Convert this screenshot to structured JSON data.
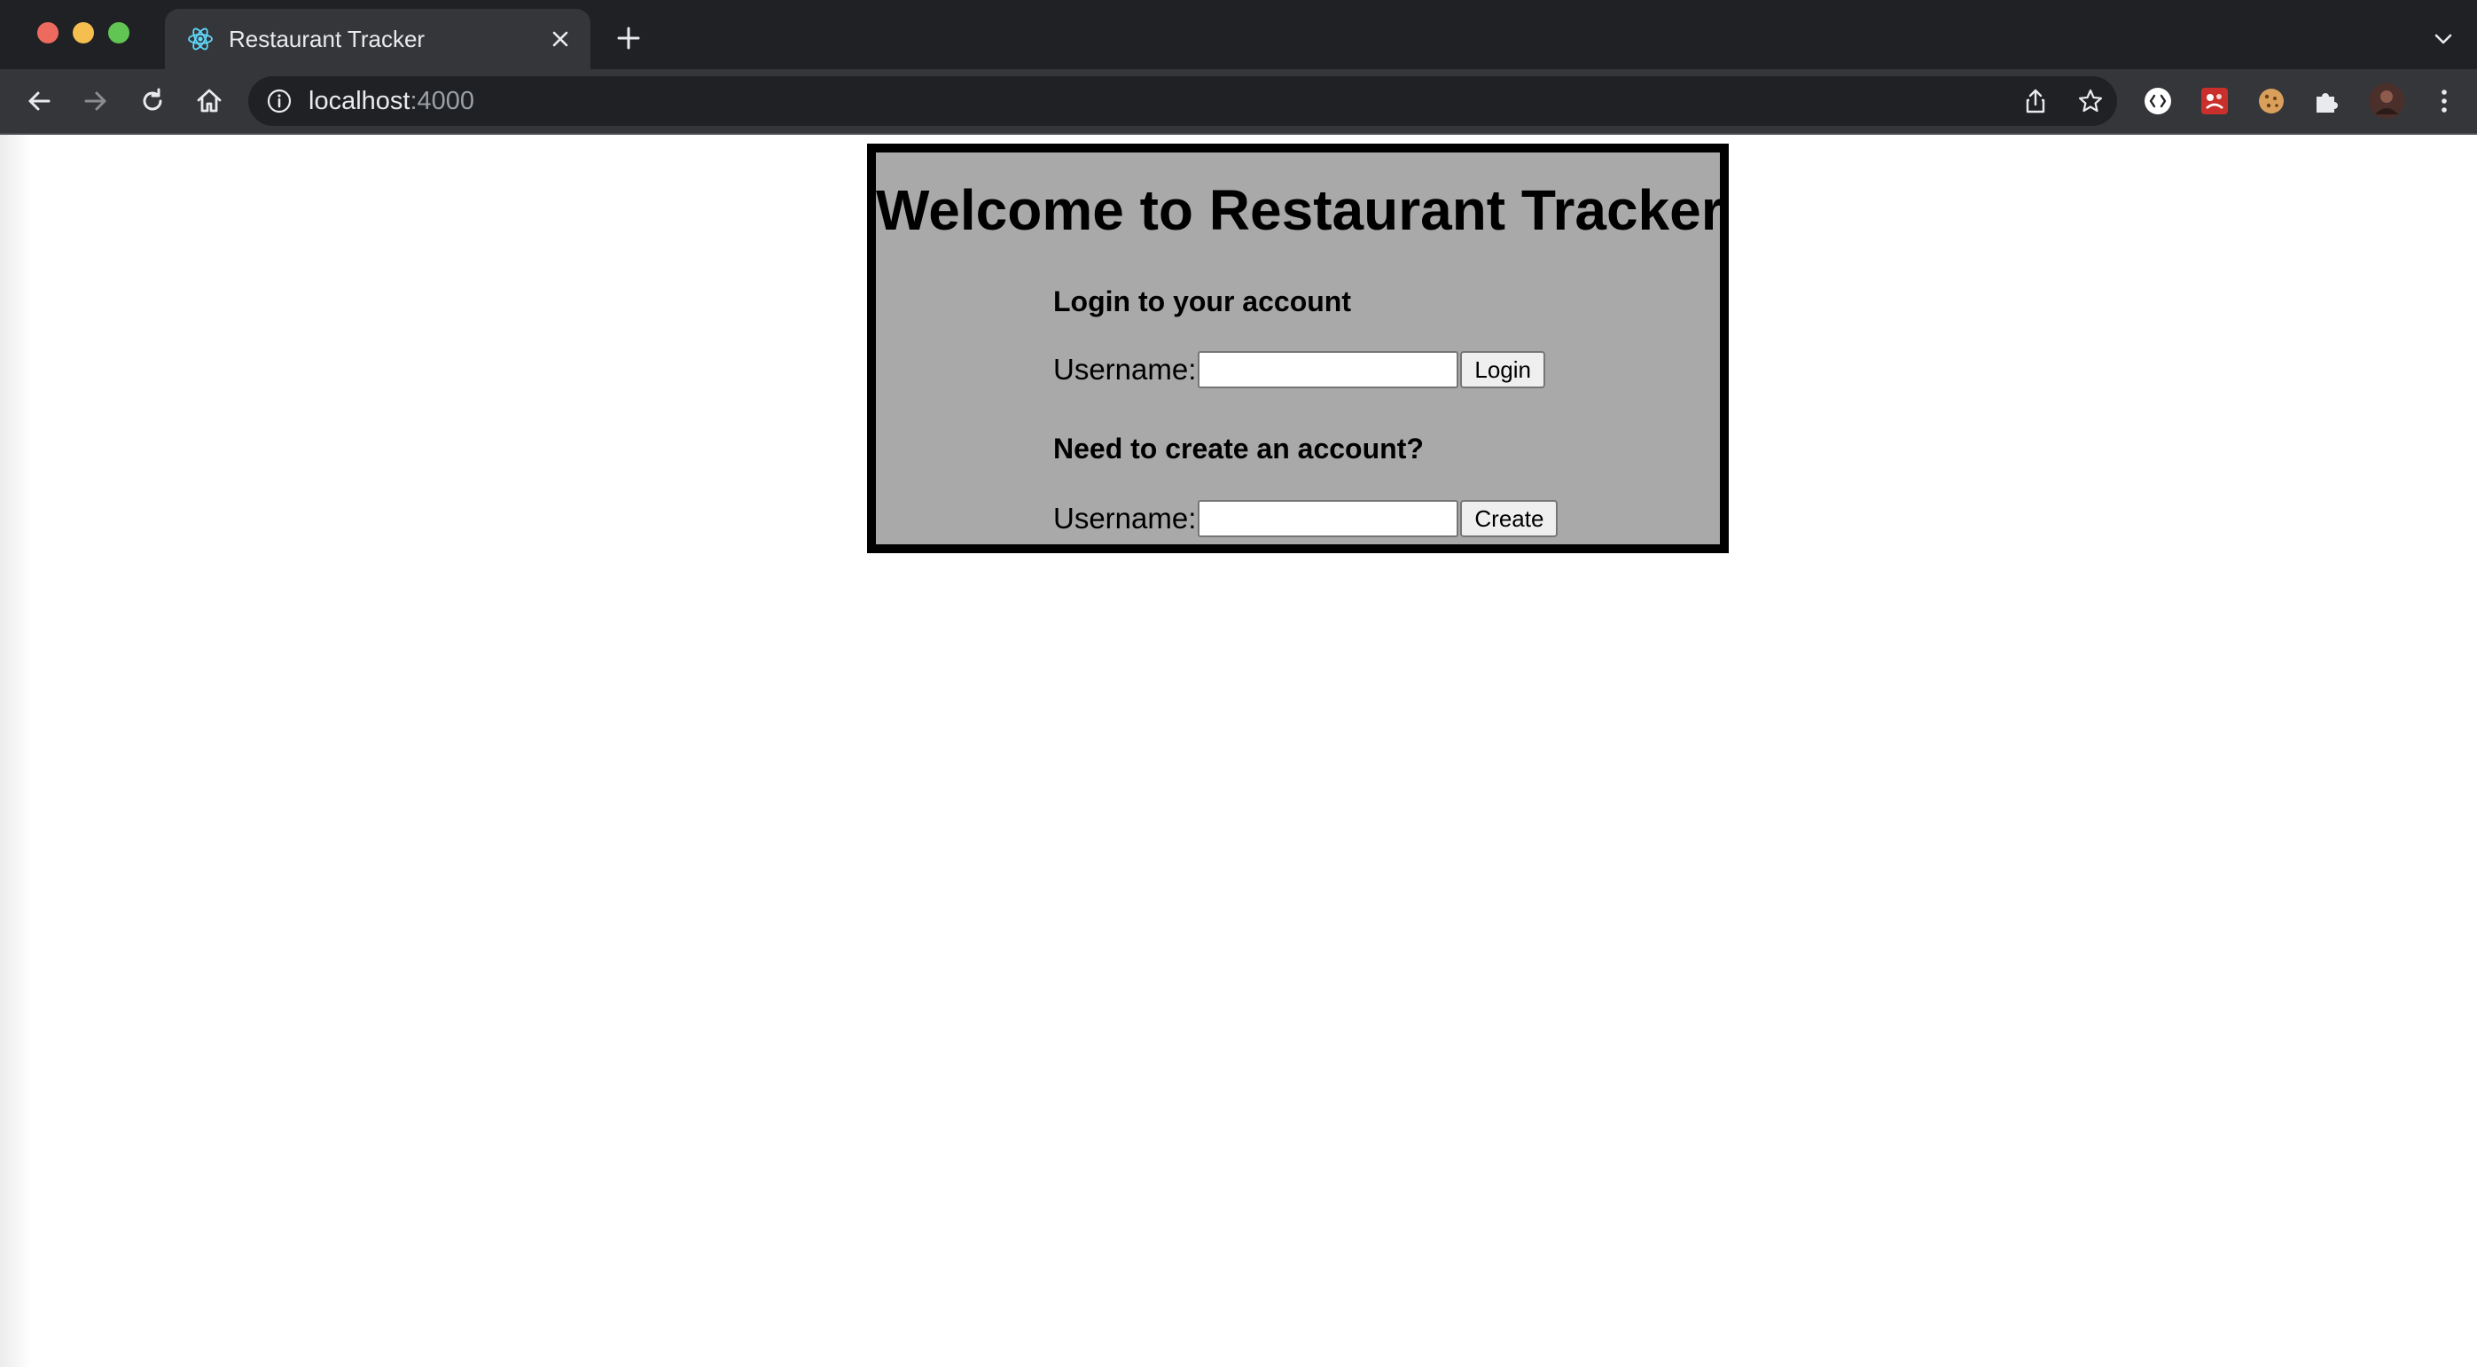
{
  "browser": {
    "tab": {
      "title": "Restaurant Tracker",
      "favicon": "react-logo-icon"
    },
    "address": {
      "host": "localhost",
      "port": ":4000"
    },
    "colors": {
      "frame": "#202124",
      "toolbar": "#35363a",
      "text": "#e8eaed"
    }
  },
  "page": {
    "heading": "Welcome to Restaurant Tracker",
    "login": {
      "heading": "Login to your account",
      "label": "Username:",
      "value": "",
      "button": "Login"
    },
    "create": {
      "heading": "Need to create an account?",
      "label": "Username:",
      "value": "",
      "button": "Create"
    },
    "colors": {
      "card_background": "#a9a9a9",
      "card_border": "#000000"
    }
  }
}
